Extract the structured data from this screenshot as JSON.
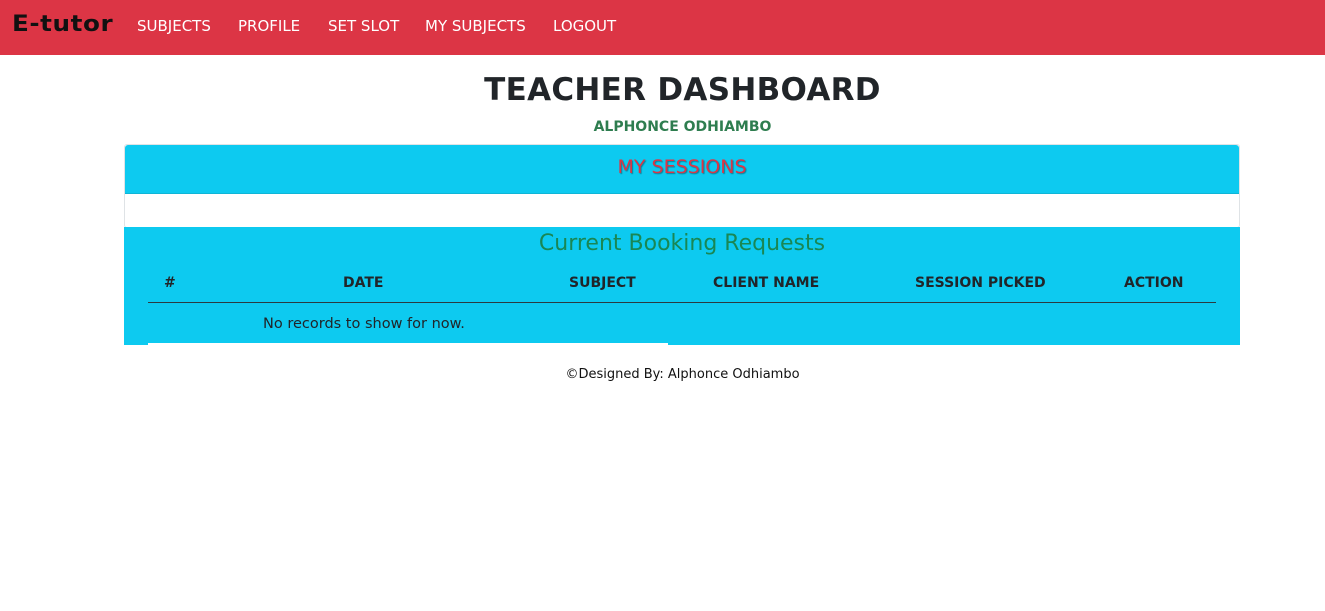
{
  "navbar": {
    "brand": "E-tutor",
    "links": [
      "SUBJECTS",
      "PROFILE",
      "SET SLOT",
      "MY SUBJECTS",
      "LOGOUT"
    ],
    "background": "#dc3545"
  },
  "main": {
    "title": "TEACHER DASHBOARD",
    "teacher_name": "ALPHONCE ODHIAMBO",
    "sessions": {
      "title": "MY SESSIONS"
    },
    "booking": {
      "title": "Current Booking Requests",
      "columns": [
        "#",
        "DATE",
        "SUBJECT",
        "CLIENT NAME",
        "SESSION PICKED",
        "ACTION"
      ],
      "empty_message": "No records to show for now."
    }
  },
  "footer": {
    "text": "©Designed By: Alphonce Odhiambo"
  },
  "colors": {
    "accent_red": "#dc3545",
    "panel_cyan": "#0dcaf0",
    "green_title": "#198754",
    "green_name": "#2e7d4f"
  }
}
